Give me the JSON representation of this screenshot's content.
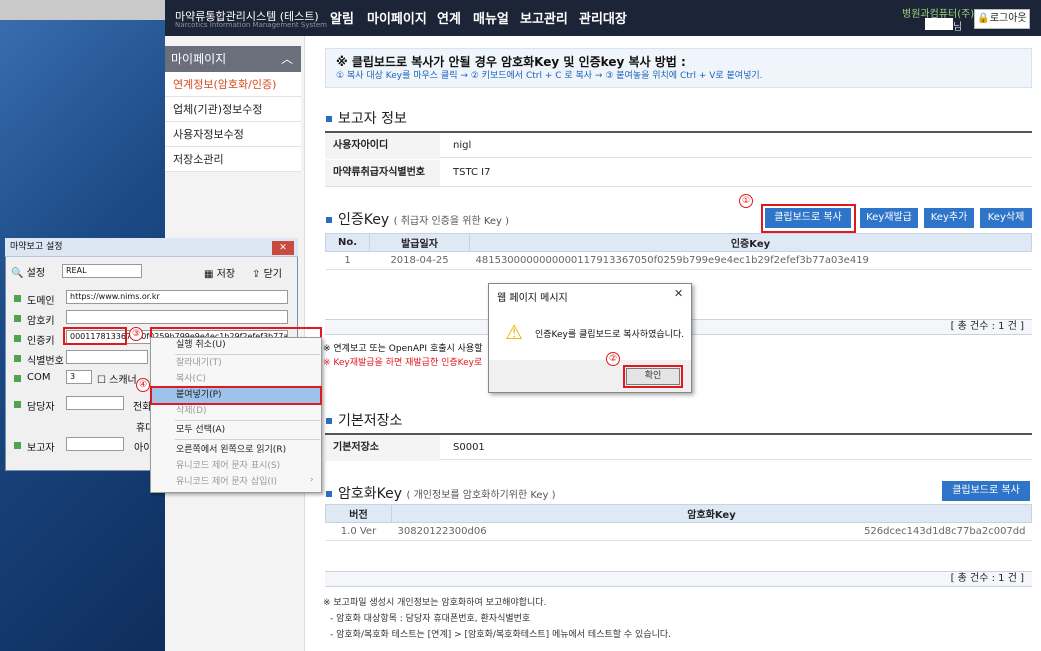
{
  "header": {
    "brand": "마약류통합관리시스템 (테스트)",
    "brand_sub": "Narcotics Information Management System",
    "nav": [
      "알림",
      "마이페이지",
      "연계",
      "매뉴얼",
      "보고관리",
      "관리대장"
    ],
    "user_name": "병원과컴퓨터(주)",
    "user_suffix": "님",
    "logout": "로그아웃"
  },
  "sidebar": {
    "title": "마이페이지",
    "items": [
      "연계정보(암호화/인증)",
      "업체(기관)정보수정",
      "사용자정보수정",
      "저장소관리"
    ]
  },
  "notice": {
    "title": "※ 클립보드로 복사가 안될 경우 암호화Key 및 인증key 복사 방법 :",
    "steps": "① 복사 대상 Key를 마우스 클릭 → ② 키보드에서 Ctrl + C 로 복사 → ③ 붙여놓을 위치에 Ctrl + V로 붙여넣기."
  },
  "reporter": {
    "title": "보고자 정보",
    "rows": [
      {
        "label": "사용자아이디",
        "value": "nigl"
      },
      {
        "label": "마약류취급자식별번호",
        "value": "TSTC      I7"
      }
    ]
  },
  "auth": {
    "title": "인증Key",
    "subtitle": "( 취급자 인증을 위한 Key )",
    "buttons": [
      "클립보드로 복사",
      "Key재발급",
      "Key추가",
      "Key삭제"
    ],
    "columns": [
      "No.",
      "발급일자",
      "인증Key"
    ],
    "rows": [
      {
        "no": "1",
        "date": "2018-04-25",
        "key": "4815300000000000117913367050f0259b799e9e4ec1b29f2efef3b77a03e419"
      }
    ],
    "count": "[ 총 건수 : 1 건 ]",
    "note1": "※ 연계보고 또는 OpenAPI 호출시 사용할",
    "note2": "※ Key재발급을 하면 재발급한 인증Key로"
  },
  "storage": {
    "title": "기본저장소",
    "label": "기본저장소",
    "value": "S0001"
  },
  "crypto": {
    "title": "암호화Key",
    "subtitle": "( 개인정보를 암호화하기위한 Key )",
    "button": "클립보드로 복사",
    "columns": [
      "버전",
      "암호화Key"
    ],
    "rows": [
      {
        "ver": "1.0 Ver",
        "key": "30820122300d06",
        "key_tail": "526dcec143d1d8c77ba2c007dd"
      }
    ],
    "count": "[ 총 건수 : 1 건 ]"
  },
  "footer_notes": [
    "※ 보고파일 생성시 개인정보는 암호화하여 보고해야합니다.",
    "- 암호화 대상항목 : 담당자 휴대폰번호, 환자식별번호",
    "- 암호화/복호화 테스트는 [연계] > [암호화/복호화테스트] 메뉴에서 테스트할 수 있습니다."
  ],
  "app": {
    "title": "마약보고 설정",
    "setting_label": "설정",
    "setting_value": "REAL",
    "save": "저장",
    "close": "닫기",
    "fields": [
      {
        "label": "도메인",
        "value": "https://www.nims.or.kr"
      },
      {
        "label": "암호키",
        "value": ""
      },
      {
        "label": "인증키",
        "value": "000117813367650f0259b799e9e4ec1b29f2efef3b77a03e419"
      },
      {
        "label": "식별번호",
        "value": ""
      },
      {
        "label": "COM",
        "value": "3"
      },
      {
        "label": "담당자",
        "value": ""
      },
      {
        "label": "보고자",
        "value": ""
      }
    ],
    "com_check": "스캐너",
    "phone_label": "전화",
    "mobile_label": "휴대",
    "reporter_extra": "아이"
  },
  "context_menu": {
    "items": [
      {
        "label": "실행 취소(U)",
        "disabled": false
      },
      {
        "label": "잘라내기(T)",
        "disabled": true
      },
      {
        "label": "복사(C)",
        "disabled": true
      },
      {
        "label": "붙여넣기(P)",
        "disabled": false,
        "highlight": true
      },
      {
        "label": "삭제(D)",
        "disabled": true
      },
      {
        "label": "모두 선택(A)",
        "disabled": false
      },
      {
        "label": "오른쪽에서 왼쪽으로 읽기(R)",
        "disabled": false
      },
      {
        "label": "유니코드 제어 문자 표시(S)",
        "disabled": true
      },
      {
        "label": "유니코드 제어 문자 삽입(I)",
        "disabled": true
      }
    ]
  },
  "dialog": {
    "title": "웹 페이지 메시지",
    "message": "인증Key를 클립보드로 복사하였습니다.",
    "ok": "확인"
  },
  "markers": [
    "①",
    "②",
    "③",
    "④"
  ]
}
